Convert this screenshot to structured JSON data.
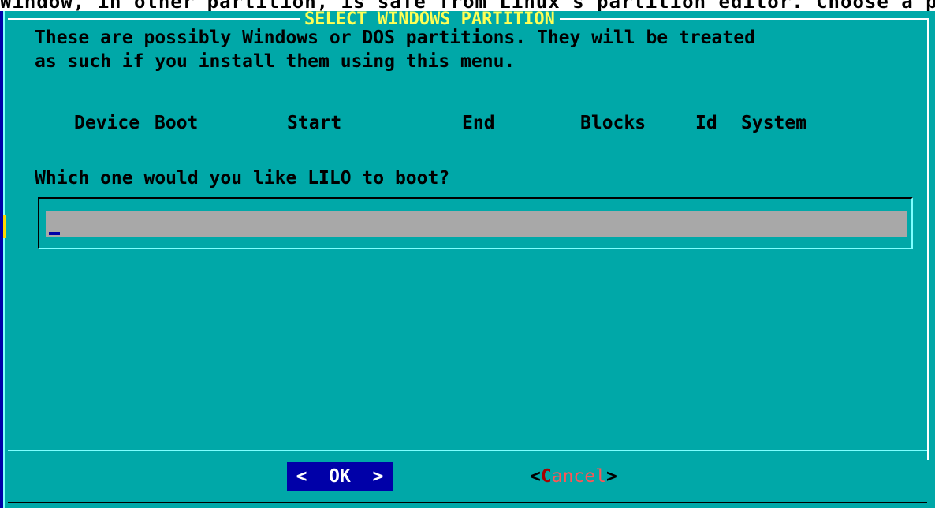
{
  "screen": {
    "top_strip_text": "Window, in other partition, is safe from Linux's partition editor. Choose a partition..."
  },
  "dialog": {
    "title": "SELECT WINDOWS PARTITION",
    "description_line1": "These are possibly Windows or DOS partitions. They will be treated",
    "description_line2": "as such if you install them using this menu.",
    "columns": {
      "device": "Device",
      "boot": "Boot",
      "start": "Start",
      "end": "End",
      "blocks": "Blocks",
      "id": "Id",
      "system": "System"
    },
    "prompt": "Which one would you like LILO to boot?",
    "input": {
      "value": ""
    },
    "buttons": {
      "ok_label": "<  OK  >",
      "cancel_open": "<",
      "cancel_hotkey": "C",
      "cancel_rest": "ancel",
      "cancel_close": ">"
    }
  },
  "colors": {
    "background": "#00a8a8",
    "title": "#ffff55",
    "button_focus": "#0000a8",
    "input_bg": "#a8a8a8",
    "hotkey": "#a80000"
  }
}
